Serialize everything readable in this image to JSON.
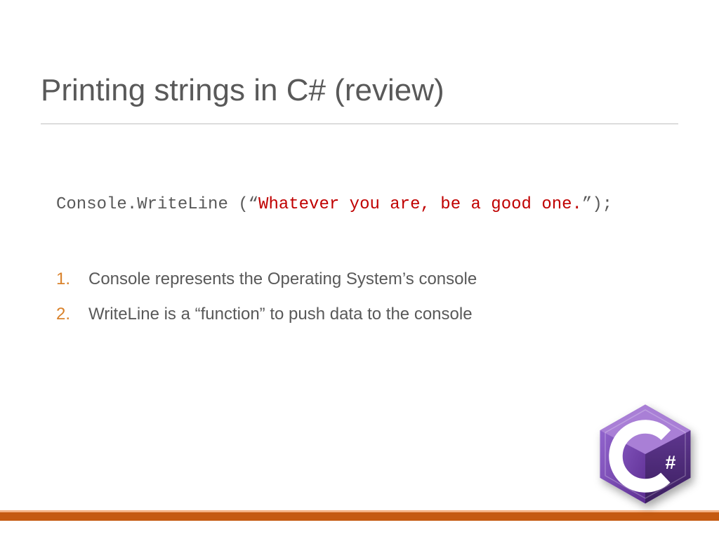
{
  "title": "Printing strings in C# (review)",
  "code": {
    "prefix": "Console.WriteLine (“",
    "string": "Whatever you are, be a good one.",
    "suffix": "”);"
  },
  "bullets": [
    "Console represents the Operating System’s console",
    "WriteLine is a “function” to push data to the console"
  ],
  "logo": {
    "letter": "C",
    "hash": "#"
  }
}
